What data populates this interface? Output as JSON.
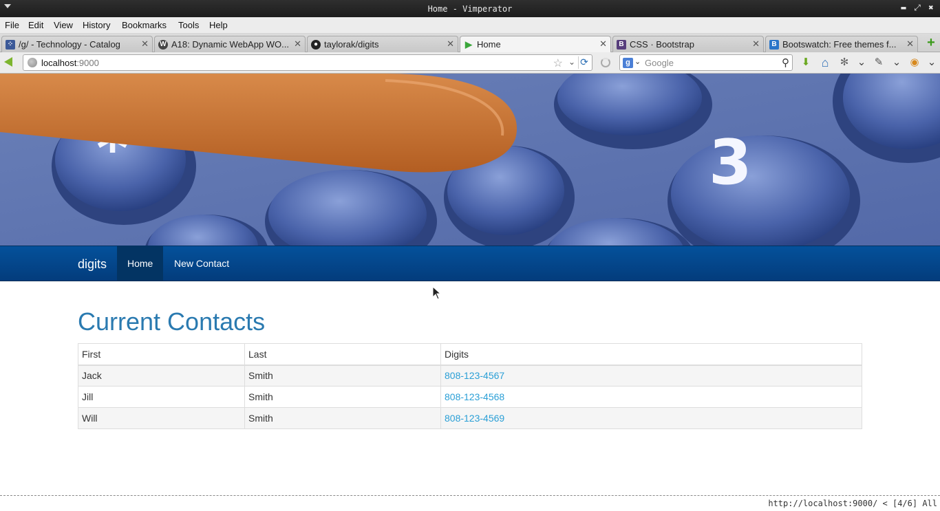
{
  "window": {
    "title": "Home - Vimperator",
    "minimize_glyph": "▬",
    "restore_glyph": "⤢",
    "close_glyph": "✖"
  },
  "menubar": [
    "File",
    "Edit",
    "View",
    "History",
    "Bookmarks",
    "Tools",
    "Help"
  ],
  "tabs": [
    {
      "label": "/g/ - Technology - Catalog",
      "icon": "grid-icon",
      "icon_glyph": "⁘",
      "icon_color": "#3b5998",
      "active": false
    },
    {
      "label": "A18: Dynamic WebApp WO...",
      "icon": "wordpress-icon",
      "icon_glyph": "W",
      "icon_color": "#464646",
      "active": false
    },
    {
      "label": "taylorak/digits",
      "icon": "github-icon",
      "icon_glyph": "●",
      "icon_color": "#222222",
      "active": false
    },
    {
      "label": "Home",
      "icon": "play-icon",
      "icon_glyph": "▶",
      "icon_color": "#3aa63a",
      "active": true
    },
    {
      "label": "CSS · Bootstrap",
      "icon": "bootstrap-icon",
      "icon_glyph": "B",
      "icon_color": "#563d7c",
      "active": false
    },
    {
      "label": "Bootswatch: Free themes f...",
      "icon": "bootswatch-icon",
      "icon_glyph": "B",
      "icon_color": "#2a75c9",
      "active": false
    }
  ],
  "tab_close_glyph": "✕",
  "new_tab_glyph": "+",
  "navbar": {
    "url_host": "localhost",
    "url_port": ":9000",
    "search_placeholder": "Google",
    "search_engine_glyph": "g",
    "star_glyph": "☆",
    "drop_glyph": "⌄",
    "reload_glyph": "⟳",
    "mag_glyph": "⚲"
  },
  "toolbar_icons": [
    {
      "name": "download-icon",
      "glyph": "⬇",
      "color": "#6aa820"
    },
    {
      "name": "home-icon",
      "glyph": "⌂",
      "color": "#2f6fb7"
    },
    {
      "name": "bug-icon",
      "glyph": "✻",
      "color": "#666666"
    },
    {
      "name": "chevron-down-icon",
      "glyph": "⌄",
      "color": "#444444"
    },
    {
      "name": "wrench-icon",
      "glyph": "✎",
      "color": "#555555"
    },
    {
      "name": "chevron-down-icon",
      "glyph": "⌄",
      "color": "#444444"
    },
    {
      "name": "addon-icon",
      "glyph": "◉",
      "color": "#d7891e"
    },
    {
      "name": "chevron-down-icon",
      "glyph": "⌄",
      "color": "#444444"
    }
  ],
  "site": {
    "brand": "digits",
    "nav": [
      "Home",
      "New Contact"
    ],
    "active_nav": "Home",
    "heading": "Current Contacts",
    "columns": [
      "First",
      "Last",
      "Digits"
    ],
    "rows": [
      {
        "first": "Jack",
        "last": "Smith",
        "digits": "808-123-4567"
      },
      {
        "first": "Jill",
        "last": "Smith",
        "digits": "808-123-4568"
      },
      {
        "first": "Will",
        "last": "Smith",
        "digits": "808-123-4569"
      }
    ]
  },
  "statusline": "http://localhost:9000/ < [4/6] All",
  "colors": {
    "navbar_blue": "#04519b",
    "heading_blue": "#2a7ab0",
    "link_blue": "#2a9fd6"
  }
}
